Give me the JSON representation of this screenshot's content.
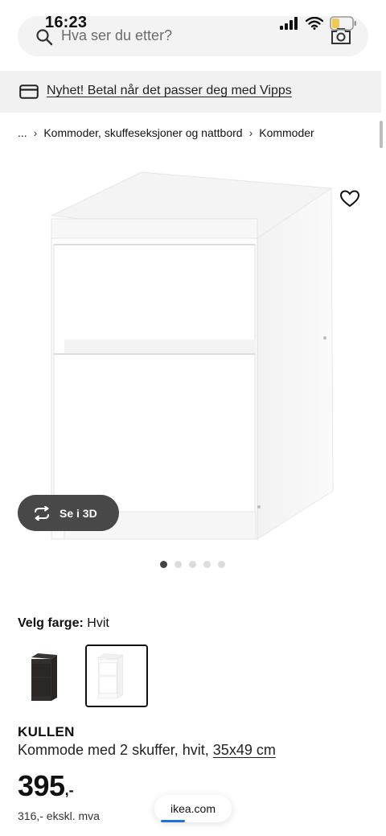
{
  "status_bar": {
    "time": "16:23"
  },
  "search": {
    "placeholder": "Hva ser du etter?"
  },
  "promo": {
    "text": "Nyhet! Betal når det passer deg med Vipps"
  },
  "breadcrumb": {
    "items": [
      "...",
      "Kommoder, skuffeseksjoner og nattbord",
      "Kommoder"
    ]
  },
  "gallery": {
    "see_3d_label": "Se i 3D",
    "image_count": 5,
    "active_index": 0
  },
  "color_picker": {
    "label": "Velg farge:",
    "selected": "Hvit"
  },
  "product": {
    "name": "KULLEN",
    "description": "Kommode med 2 skuffer, hvit,",
    "size": "35x49 cm",
    "price": "395",
    "price_suffix": ",-",
    "price_ex_vat": "316,- ekskl. mva"
  },
  "browser": {
    "url": "ikea.com"
  },
  "colors": {
    "accent_blue": "#1f6fe0",
    "button_dark": "#484848",
    "banner_bg": "#f1f1f1"
  }
}
